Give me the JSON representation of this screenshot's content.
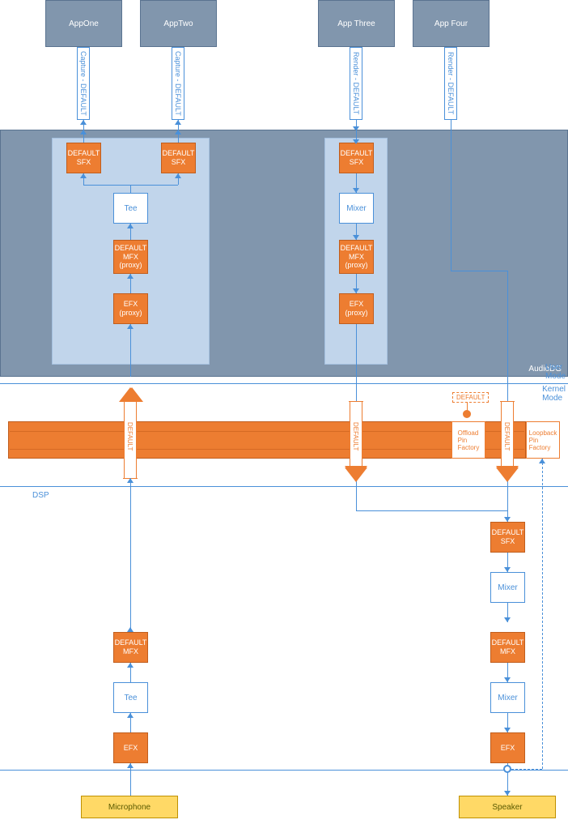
{
  "apps": {
    "one": "AppOne",
    "two": "AppTwo",
    "three": "App Three",
    "four": "App Four"
  },
  "connectors": {
    "captureDefault": "Capture - DEFAULT",
    "renderDefault": "Render - DEFAULT"
  },
  "boxes": {
    "defaultSfx": "DEFAULT\nSFX",
    "defaultMfx": "DEFAULT\nMFX",
    "defaultMfxProxy": "DEFAULT\nMFX\n(proxy)",
    "efx": "EFX",
    "efxProxy": "EFX\n(proxy)",
    "tee": "Tee",
    "mixer": "Mixer",
    "offloadPin": "Offload\nPin\nFactory",
    "loopbackPin": "Loopback\nPin\nFactory"
  },
  "labels": {
    "audiodg": "AudioDG",
    "userMode": "User\nMode",
    "kernelMode": "Kernel\nMode",
    "default": "DEFAULT",
    "dsp": "DSP"
  },
  "devices": {
    "mic": "Microphone",
    "speaker": "Speaker"
  }
}
